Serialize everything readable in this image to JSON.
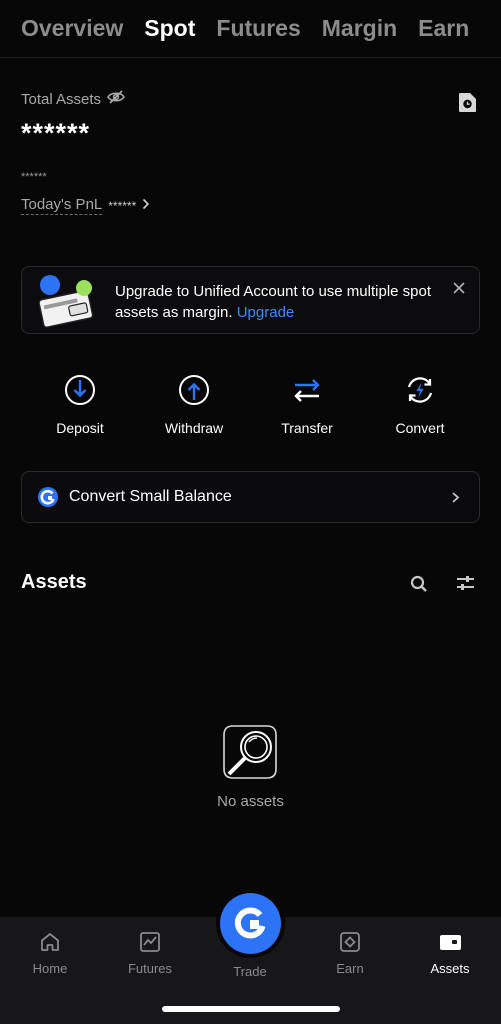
{
  "top_tabs": [
    "Overview",
    "Spot",
    "Futures",
    "Margin",
    "Earn"
  ],
  "active_tab": "Spot",
  "total_assets": {
    "label": "Total Assets",
    "value": "******",
    "sub_value": "******",
    "pnl_label": "Today's PnL",
    "pnl_value": "******"
  },
  "banner": {
    "text": "Upgrade to Unified Account to use multiple spot assets as margin.",
    "link": "Upgrade"
  },
  "actions": [
    {
      "label": "Deposit",
      "icon": "deposit-icon"
    },
    {
      "label": "Withdraw",
      "icon": "withdraw-icon"
    },
    {
      "label": "Transfer",
      "icon": "transfer-icon"
    },
    {
      "label": "Convert",
      "icon": "convert-icon"
    }
  ],
  "convert_small_balance": {
    "label": "Convert Small Balance"
  },
  "assets_section": {
    "title": "Assets",
    "empty_text": "No assets"
  },
  "bottom_nav": [
    {
      "label": "Home",
      "icon": "home-icon"
    },
    {
      "label": "Futures",
      "icon": "futures-chart-icon"
    },
    {
      "label": "Trade",
      "icon": "trade-logo-icon"
    },
    {
      "label": "Earn",
      "icon": "earn-icon"
    },
    {
      "label": "Assets",
      "icon": "wallet-icon"
    }
  ],
  "active_nav": "Assets",
  "colors": {
    "background": "#070707",
    "accent": "#2d73f5",
    "link": "#3d8bfd",
    "muted_text": "#a8a8aa",
    "nav_background": "#171719"
  }
}
